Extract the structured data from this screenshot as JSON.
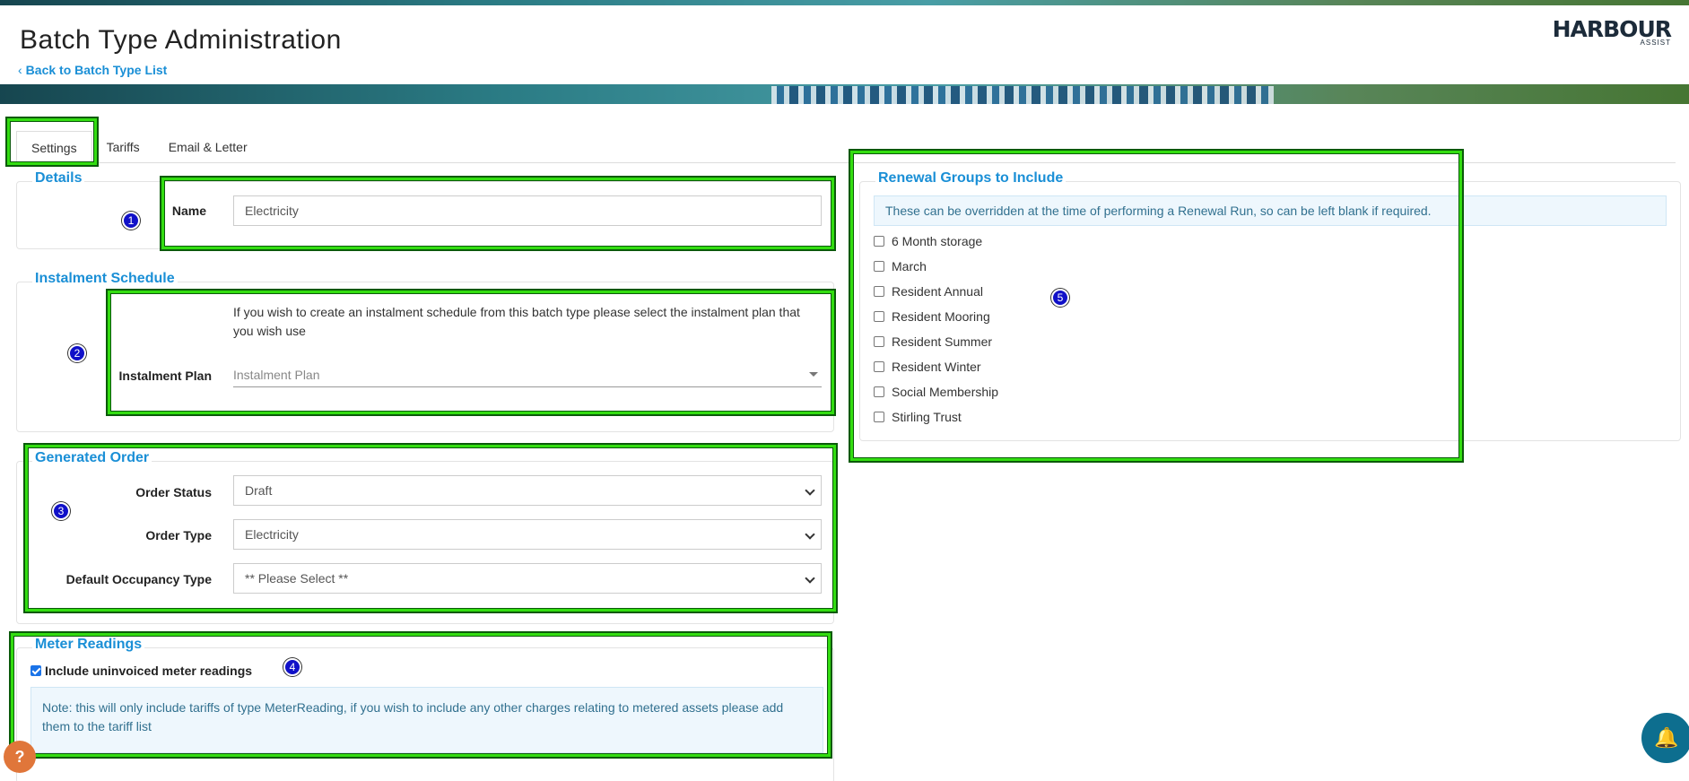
{
  "header": {
    "title": "Batch Type Administration",
    "back_link": "Back to Batch Type List",
    "logo_main": "HARBOUR",
    "logo_sub": "ASSIST"
  },
  "tabs": [
    {
      "label": "Settings",
      "active": true
    },
    {
      "label": "Tariffs",
      "active": false
    },
    {
      "label": "Email & Letter",
      "active": false
    }
  ],
  "details": {
    "legend": "Details",
    "name_label": "Name",
    "name_value": "Electricity"
  },
  "instalment": {
    "legend": "Instalment Schedule",
    "help_text": "If you wish to create an instalment schedule from this batch type please select the instalment plan that you wish use",
    "plan_label": "Instalment Plan",
    "plan_placeholder": "Instalment Plan"
  },
  "generated_order": {
    "legend": "Generated Order",
    "status_label": "Order Status",
    "status_value": "Draft",
    "type_label": "Order Type",
    "type_value": "Electricity",
    "occupancy_label": "Default Occupancy Type",
    "occupancy_value": "** Please Select **"
  },
  "meter_readings": {
    "legend": "Meter Readings",
    "include_label": "Include uninvoiced meter readings",
    "include_checked": true,
    "note": "Note: this will only include tariffs of type MeterReading, if you wish to include any other charges relating to metered assets please add them to the tariff list"
  },
  "renewal_groups": {
    "legend": "Renewal Groups to Include",
    "info": "These can be overridden at the time of performing a Renewal Run, so can be left blank if required.",
    "items": [
      {
        "label": "6 Month storage",
        "checked": false
      },
      {
        "label": "March",
        "checked": false
      },
      {
        "label": "Resident Annual",
        "checked": false
      },
      {
        "label": "Resident Mooring",
        "checked": false
      },
      {
        "label": "Resident Summer",
        "checked": false
      },
      {
        "label": "Resident Winter",
        "checked": false
      },
      {
        "label": "Social Membership",
        "checked": false
      },
      {
        "label": "Stirling Trust",
        "checked": false
      }
    ]
  },
  "annotations": [
    "1",
    "2",
    "3",
    "4",
    "5"
  ],
  "icons": {
    "back": "chevron-left-icon",
    "notifications": "bell-icon",
    "help": "help-icon"
  },
  "colors": {
    "accent": "#1a8fd6",
    "highlight": "#33dd11",
    "badge": "#1010c8"
  }
}
